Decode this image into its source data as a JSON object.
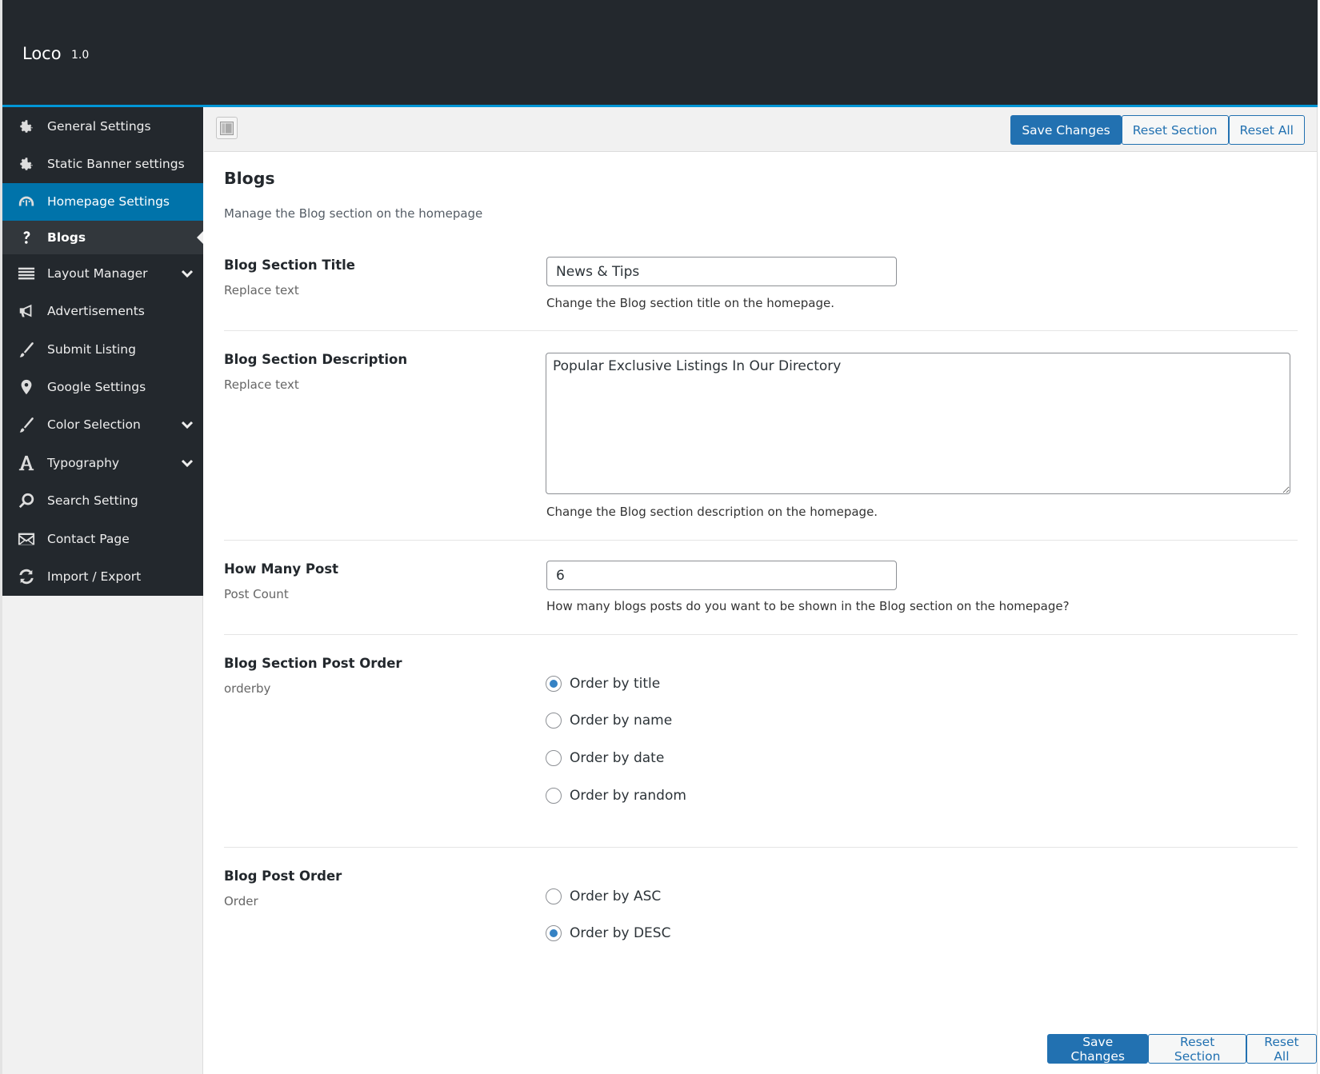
{
  "app": {
    "name": "Loco",
    "version": "1.0"
  },
  "sidebar": {
    "items": [
      {
        "label": "General Settings",
        "icon": "gear-icon"
      },
      {
        "label": "Static Banner settings",
        "icon": "gear-icon"
      },
      {
        "label": "Homepage Settings",
        "icon": "dashboard-gauge-icon",
        "active": true
      },
      {
        "label": "Blogs",
        "icon": "question-icon",
        "current_sub": true
      },
      {
        "label": "Layout Manager",
        "icon": "list-lines-icon",
        "expandable": true
      },
      {
        "label": "Advertisements",
        "icon": "megaphone-icon"
      },
      {
        "label": "Submit Listing",
        "icon": "brush-icon"
      },
      {
        "label": "Google Settings",
        "icon": "location-pin-icon"
      },
      {
        "label": "Color Selection",
        "icon": "brush-icon",
        "expandable": true
      },
      {
        "label": "Typography",
        "icon": "letter-a-icon",
        "expandable": true
      },
      {
        "label": "Search Setting",
        "icon": "search-icon"
      },
      {
        "label": "Contact Page",
        "icon": "envelope-icon"
      },
      {
        "label": "Import / Export",
        "icon": "refresh-icon"
      }
    ]
  },
  "toolbar": {
    "save_label": "Save Changes",
    "reset_section_label": "Reset Section",
    "reset_all_label": "Reset All"
  },
  "section": {
    "title": "Blogs",
    "description": "Manage the Blog section on the homepage"
  },
  "fields": {
    "blog_title": {
      "label": "Blog Section Title",
      "sublabel": "Replace text",
      "value": "News & Tips",
      "help": "Change the Blog section title on the homepage."
    },
    "blog_description": {
      "label": "Blog Section Description",
      "sublabel": "Replace text",
      "value": "Popular Exclusive Listings In Our Directory",
      "help": "Change the Blog section description on the homepage."
    },
    "post_count": {
      "label": "How Many Post",
      "sublabel": "Post Count",
      "value": "6",
      "help": "How many blogs posts do you want to be shown in the Blog section on the homepage?"
    },
    "post_orderby": {
      "label": "Blog Section Post Order",
      "sublabel": "orderby",
      "options": [
        "Order by title",
        "Order by name",
        "Order by date",
        "Order by random"
      ],
      "selected": "Order by title"
    },
    "post_order": {
      "label": "Blog Post Order",
      "sublabel": "Order",
      "options": [
        "Order by ASC",
        "Order by DESC"
      ],
      "selected": "Order by DESC"
    }
  },
  "colors": {
    "header_bg": "#23282d",
    "accent_bar": "#0096d6",
    "active_nav": "#0073aa",
    "primary_button": "#2271b1",
    "radio_checked": "#3582c4"
  }
}
